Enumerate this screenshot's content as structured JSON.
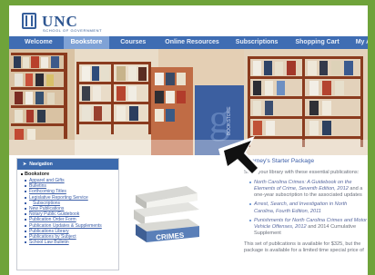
{
  "header": {
    "logo_title": "UNC",
    "logo_subtitle": "SCHOOL OF GOVERNMENT"
  },
  "navbar": {
    "items": [
      {
        "label": "Welcome",
        "active": false
      },
      {
        "label": "Bookstore",
        "active": true
      },
      {
        "label": "Courses",
        "active": false
      },
      {
        "label": "Online Resources",
        "active": false
      },
      {
        "label": "Subscriptions",
        "active": false
      },
      {
        "label": "Shopping Cart",
        "active": false
      },
      {
        "label": "My Account",
        "active": false
      }
    ]
  },
  "hero": {
    "sign_text": "BOOKSTORE"
  },
  "navigation_panel": {
    "heading": "Navigation",
    "section": "Bookstore",
    "links": [
      "Apparel and Gifts",
      "Bulletins",
      "Forthcoming Titles",
      "Legislative Reporting Service",
      "Subscriptions",
      "New Publications",
      "Notary Public Guidebook",
      "Publication Order Form",
      "Publication Updates & Supplements",
      "Publications Library",
      "Publications by Subject",
      "School Law Bulletin"
    ]
  },
  "book_stack": {
    "cover_text": "CRIMES"
  },
  "content": {
    "title": "Attorney's Starter Package",
    "intro": "Stock your library with these essential publications:",
    "items": [
      {
        "title": "North Carolina Crimes: A Guidebook on the Elements of Crime, Seventh Edition, 2012",
        "note": "and a one-year subscription to the associated updates"
      },
      {
        "title": "Arrest, Search, and Investigation in North Carolina, Fourth Edition, 2011",
        "note": ""
      },
      {
        "title": "Punishments for North Carolina Crimes and Motor Vehicle Offenses, 2012",
        "note": "and 2014 Cumulative Supplement"
      }
    ],
    "footer": "This set of publications is available for $325, but the package is available for a limited time special price of"
  },
  "colors": {
    "page_bg": "#6fa33a",
    "nav_bg": "#3f6db3",
    "nav_active": "#7fa2d6",
    "link": "#3b5ea8"
  }
}
